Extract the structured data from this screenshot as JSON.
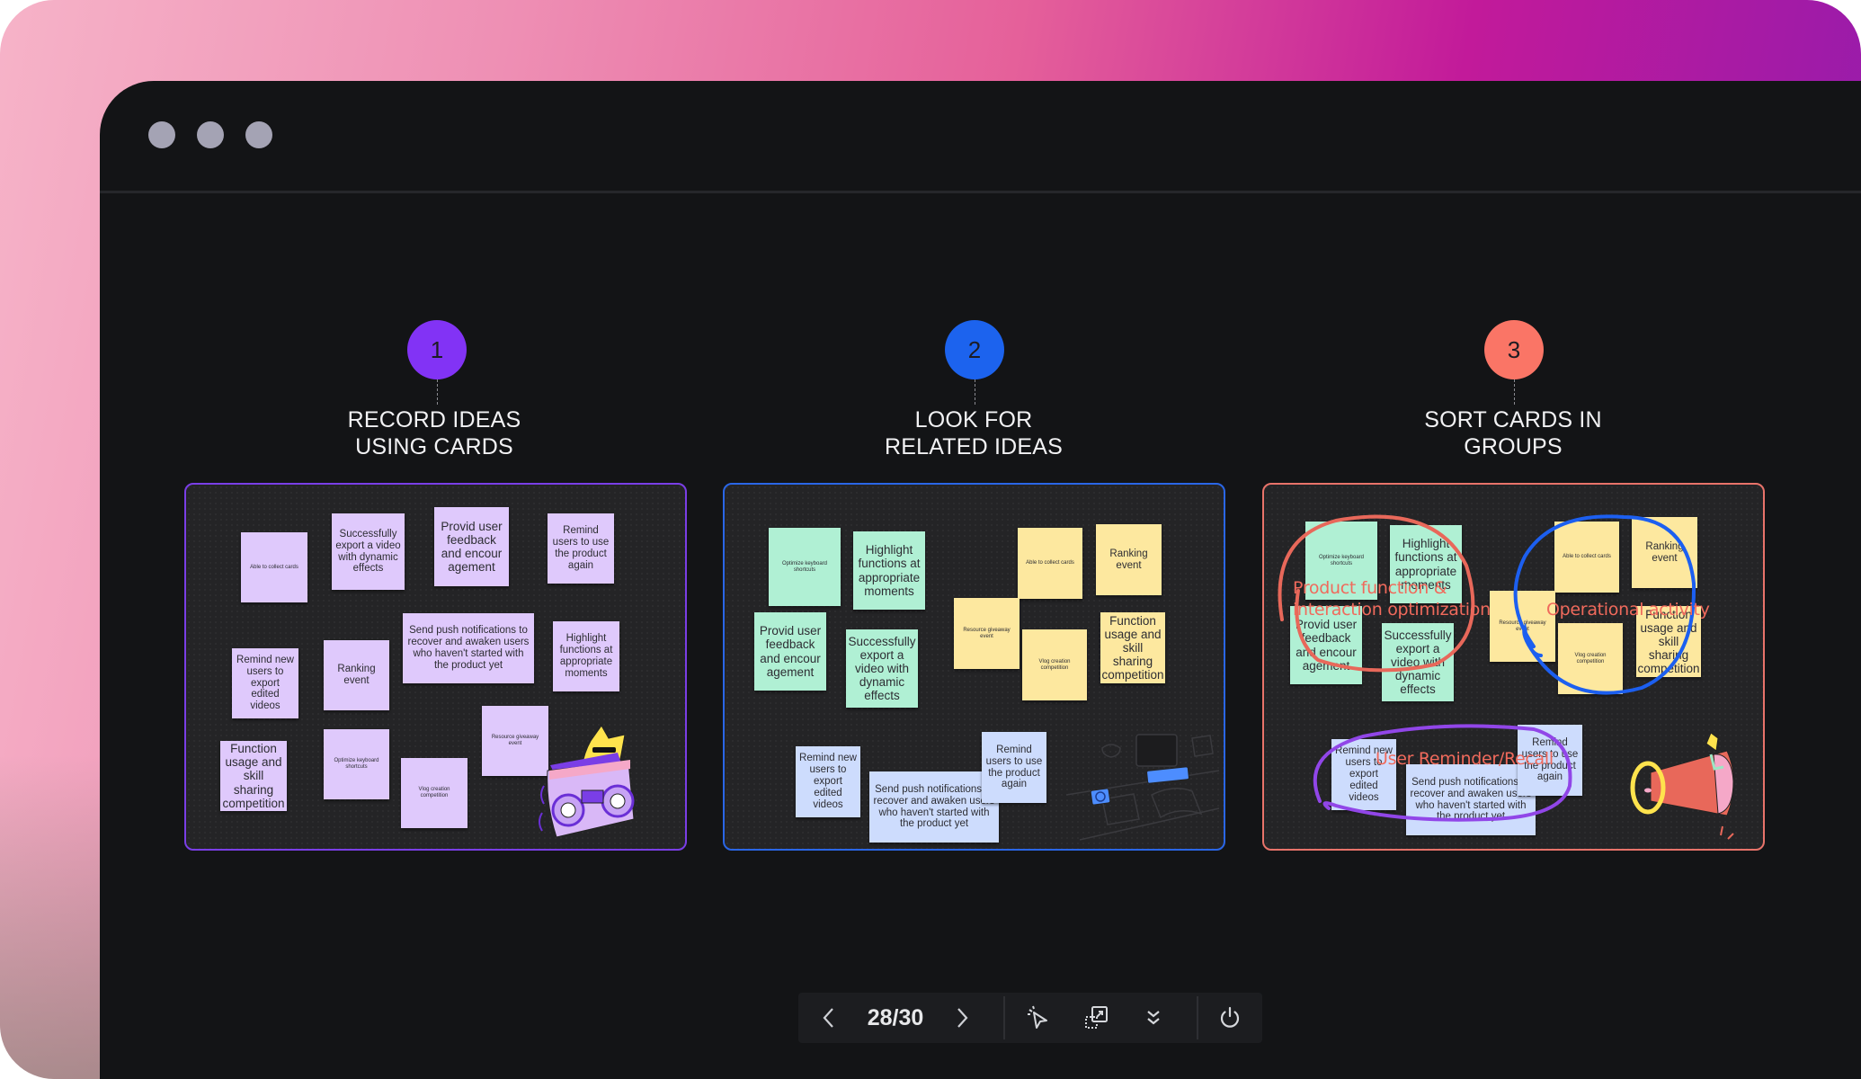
{
  "window": {
    "controls": [
      "window-dot-1",
      "window-dot-2",
      "window-dot-3"
    ]
  },
  "colors": {
    "step1": "#8233f5",
    "step2": "#1c63ee",
    "step3": "#fa7566",
    "panel1_border": "#7a3ee6",
    "panel2_border": "#2a66e6",
    "panel3_border": "#e8736a",
    "group_product": "#e8685a",
    "group_operational": "#1c5ff0",
    "group_reminder": "#9146e8"
  },
  "steps": [
    {
      "number": "1",
      "title": "RECORD IDEAS\nUSING CARDS"
    },
    {
      "number": "2",
      "title": "LOOK FOR\nRELATED IDEAS"
    },
    {
      "number": "3",
      "title": "SORT CARDS IN\nGROUPS"
    }
  ],
  "panel1": {
    "cards": [
      "Able to collect cards",
      "Successfully export a video with dynamic effects",
      "Provid user feedback and encour agement",
      "Remind users to use the product again",
      "Remind new users to export edited videos",
      "Ranking event",
      "Send push notifications to recover and awaken users who haven't started with the product yet",
      "Highlight functions at appropriate moments",
      "Function usage and skill sharing competition",
      "Optimize keyboard shortcuts",
      "Vlog creation competition",
      "Resource giveaway event"
    ],
    "illustration": "boombox-character-illustration"
  },
  "panel2": {
    "cards": [
      "Optimize keyboard shortcuts",
      "Highlight functions at appropriate moments",
      "Provid user feedback and encour agement",
      "Successfully export a video with dynamic effects",
      "Able to collect cards",
      "Ranking event",
      "Resource giveaway event",
      "Vlog creation competition",
      "Function usage and skill sharing competition",
      "Remind new users to export edited videos",
      "Send push notifications to recover and awaken users who haven't started with the product yet",
      "Remind users to use the product again"
    ],
    "illustration": "desk-laptop-illustration"
  },
  "panel3": {
    "cards": [
      "Optimize keyboard shortcuts",
      "Highlight functions at appropriate moments",
      "Provid user feedback and encour agement",
      "Successfully export a video with dynamic effects",
      "Able to collect cards",
      "Ranking event",
      "Resource giveaway event",
      "Vlog creation competition",
      "Function usage and skill sharing competition",
      "Remind new users to export edited videos",
      "Send push notifications to recover and awaken users who haven't started with the product yet",
      "Remind users to use the product again"
    ],
    "groups": {
      "product": "Product function &\ninteraction optimization",
      "operational": "Operational activity",
      "reminder": "User Reminder/Recall"
    },
    "illustration": "megaphone-illustration"
  },
  "toolbar": {
    "page_current": 28,
    "page_total": 30,
    "page_label": "28/30",
    "buttons": [
      "prev-page",
      "next-page",
      "laser-pointer",
      "fit-screen",
      "collapse",
      "exit"
    ]
  }
}
